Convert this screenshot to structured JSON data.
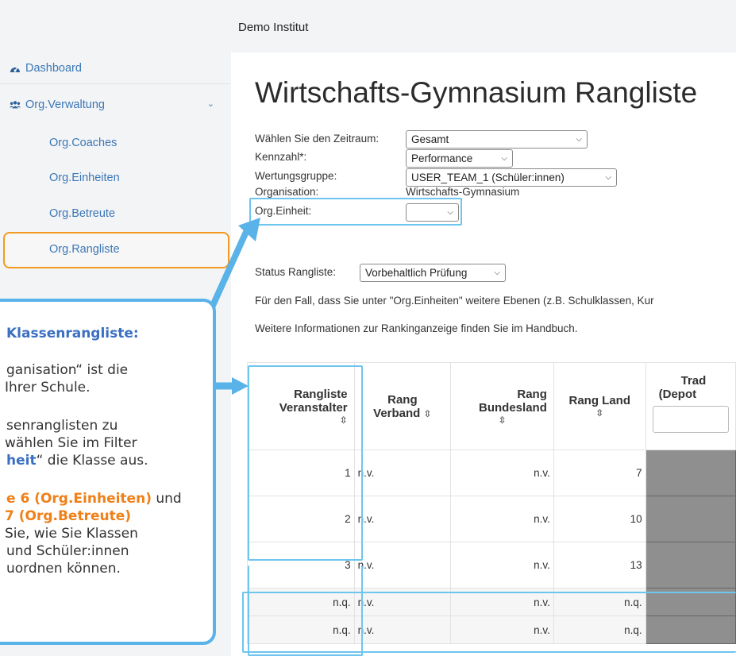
{
  "header": {
    "institute": "Demo Institut"
  },
  "sidebar": {
    "items": [
      {
        "label": "Dashboard"
      },
      {
        "label": "Org.Verwaltung"
      },
      {
        "label": "Org.Coaches"
      },
      {
        "label": "Org.Einheiten"
      },
      {
        "label": "Org.Betreute"
      },
      {
        "label": "Org.Rangliste"
      }
    ]
  },
  "main": {
    "title": "Wirtschafts-Gymnasium Rangliste",
    "filters": {
      "zeitraum_label": "Wählen Sie den Zeitraum:",
      "zeitraum_value": "Gesamt",
      "kennzahl_label": "Kennzahl*:",
      "kennzahl_value": "Performance",
      "wertungsgruppe_label": "Wertungsgruppe:",
      "wertungsgruppe_value": "USER_TEAM_1 (Schüler:innen)",
      "organisation_label": "Organisation:",
      "organisation_value": "Wirtschafts-Gymnasium",
      "orgeinheit_label": "Org.Einheit:",
      "orgeinheit_value": ""
    },
    "status_label": "Status Rangliste:",
    "status_value": "Vorbehaltlich Prüfung",
    "info_text": "Für den Fall, dass Sie unter \"Org.Einheiten\" weitere Ebenen (z.B. Schulklassen, Kur",
    "handbook_text": "Weitere Informationen zur Rankinganzeige finden Sie im Handbuch.",
    "table": {
      "headers": {
        "col1_l1": "Rangliste",
        "col1_l2": "Veranstalter",
        "col2_l1": "Rang",
        "col2_l2": "Verband",
        "col3_l1": "Rang",
        "col3_l2": "Bundesland",
        "col4": "Rang Land",
        "col5_l1": "Trad",
        "col5_l2": "(Depot"
      },
      "sort_icon": "⇳",
      "rows": [
        {
          "c1": "1",
          "c2": "n.v.",
          "c3": "n.v.",
          "c4": "7"
        },
        {
          "c1": "2",
          "c2": "n.v.",
          "c3": "n.v.",
          "c4": "10"
        },
        {
          "c1": "3",
          "c2": "n.v.",
          "c3": "n.v.",
          "c4": "13"
        },
        {
          "c1": "n.q.",
          "c2": "n.v.",
          "c3": "n.v.",
          "c4": "n.q."
        },
        {
          "c1": "n.q.",
          "c2": "n.v.",
          "c3": "n.v.",
          "c4": "n.q."
        }
      ]
    }
  },
  "callout": {
    "line1": "Klassenrangliste:",
    "line2": "ganisation“ ist die",
    "line3": " Ihrer Schule.",
    "line4": "senranglisten zu",
    "line5": " wählen Sie im Filter",
    "line6a": "heit",
    "line6b": "“ die Klasse aus.",
    "line7a": "e 6 (Org.Einheiten)",
    "line7b": " und",
    "line8": " 7 (Org.Betreute)",
    "line9": " Sie, wie Sie Klassen",
    "line10": "und Schüler:innen",
    "line11": "uordnen können."
  },
  "colors": {
    "highlight_blue": "#5ab3e8",
    "active_orange": "#f39a21",
    "link_blue": "#3b77b6",
    "gray_cell": "#8f8f8f"
  }
}
